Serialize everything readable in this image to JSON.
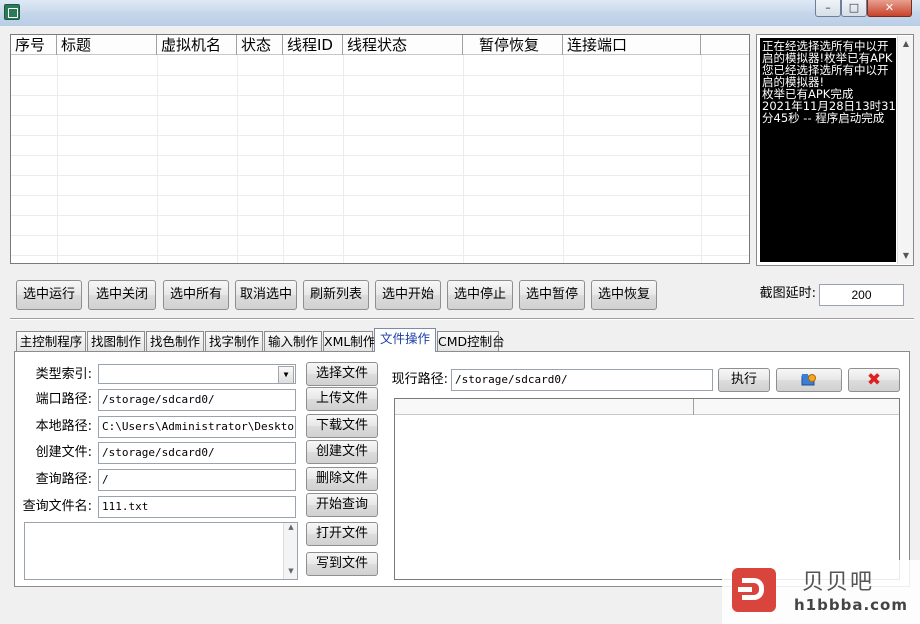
{
  "window": {
    "title": ""
  },
  "list": {
    "columns": [
      "序号",
      "标题",
      "虚拟机名",
      "状态",
      "线程ID",
      "线程状态",
      "暂停恢复",
      "连接端口"
    ]
  },
  "log": {
    "text": "正在经选择选所有中以开启的模拟器!枚举已有APK您已经选择选所有中以开启的模拟器!\n枚举已有APK完成\n2021年11月28日13时31分45秒 -- 程序启动完成"
  },
  "toolbar": {
    "buttons": [
      "选中运行",
      "选中关闭",
      "选中所有",
      "取消选中",
      "刷新列表",
      "选中开始",
      "选中停止",
      "选中暂停",
      "选中恢复"
    ],
    "delay_label": "截图延时:",
    "delay_value": "200"
  },
  "tabs": [
    "主控制程序",
    "找图制作",
    "找色制作",
    "找字制作",
    "输入制作",
    "XML制作",
    "文件操作",
    "CMD控制台"
  ],
  "active_tab": "文件操作",
  "file_ops": {
    "type_index_label": "类型索引:",
    "type_index_value": "",
    "port_path_label": "端口路径:",
    "port_path_value": "/storage/sdcard0/",
    "local_path_label": "本地路径:",
    "local_path_value": "C:\\Users\\Administrator\\Desktop\\雷",
    "create_file_label": "创建文件:",
    "create_file_value": "/storage/sdcard0/",
    "query_path_label": "查询路径:",
    "query_path_value": "/",
    "query_filename_label": "查询文件名:",
    "query_filename_value": "111.txt",
    "buttons": [
      "选择文件",
      "上传文件",
      "下载文件",
      "创建文件",
      "删除文件",
      "开始查询",
      "打开文件",
      "写到文件"
    ],
    "current_path_label": "现行路径:",
    "current_path_value": "/storage/sdcard0/",
    "execute_label": "执行"
  },
  "watermark": {
    "brand": "贝贝吧",
    "url": "h1bbba.com"
  },
  "colors": {
    "close_button": "#c8432b",
    "active_tab_text": "#1a3ea8",
    "log_bg": "#000000",
    "delete_x": "#e02020"
  }
}
